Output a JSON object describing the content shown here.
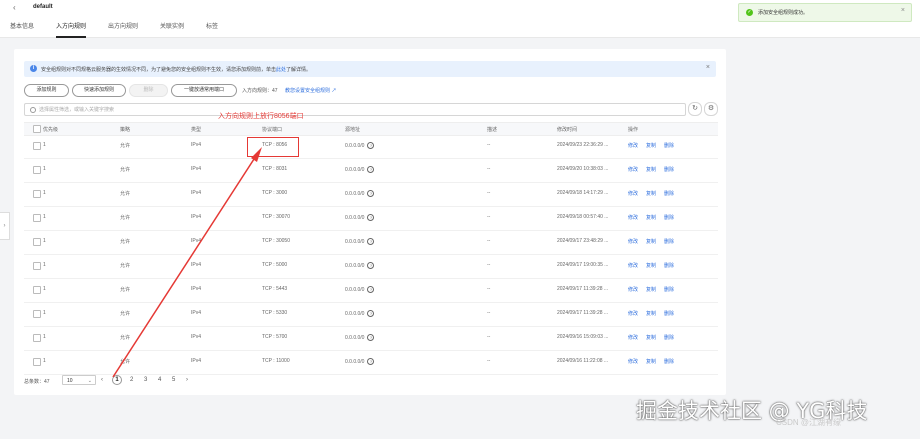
{
  "header": {
    "back_icon": "chevron-left-icon",
    "title": "default",
    "tabs": [
      {
        "label": "基本信息",
        "active": false
      },
      {
        "label": "入方向规则",
        "active": true
      },
      {
        "label": "出方向规则",
        "active": false
      },
      {
        "label": "关联实例",
        "active": false
      },
      {
        "label": "标签",
        "active": false
      }
    ]
  },
  "toast": {
    "icon": "check-circle-icon",
    "text": "添加安全组规则成功。",
    "close": "×"
  },
  "sidebar": {
    "toggle": "›"
  },
  "info_bar": {
    "icon": "info-icon",
    "text": "安全组规则对不同规格云服务器的生效情况不同，为了避免您的安全组规则不生效，请您添加规则前，单击",
    "link": "此处",
    "text_after": "了解详情。",
    "close": "×"
  },
  "toolbar": {
    "add_rule": "添加规则",
    "quick_add": "快速添加规则",
    "delete": "删除",
    "allow_common": "一键放通常用端口",
    "stat_label": "入方向规则：",
    "stat_count": "47",
    "teach_link": "教您设置安全组规则"
  },
  "search": {
    "placeholder": "选择属性筛选，或输入关键字搜索",
    "value": "",
    "refresh_icon": "↻",
    "settings_icon": "⚙"
  },
  "table": {
    "columns": [
      "优先级",
      "策略",
      "类型",
      "协议端口",
      "源地址",
      "描述",
      "修改时间",
      "操作"
    ],
    "rows": [
      {
        "priority": "1",
        "policy": "允许",
        "type": "IPv4",
        "port": "TCP : 8056",
        "source": "0.0.0.0/0",
        "desc": "--",
        "time": "2024/09/23 22:36:29 ..."
      },
      {
        "priority": "1",
        "policy": "允许",
        "type": "IPv4",
        "port": "TCP : 8031",
        "source": "0.0.0.0/0",
        "desc": "--",
        "time": "2024/09/20 10:38:03 ..."
      },
      {
        "priority": "1",
        "policy": "允许",
        "type": "IPv4",
        "port": "TCP : 3000",
        "source": "0.0.0.0/0",
        "desc": "--",
        "time": "2024/09/18 14:17:29 ..."
      },
      {
        "priority": "1",
        "policy": "允许",
        "type": "IPv4",
        "port": "TCP : 30070",
        "source": "0.0.0.0/0",
        "desc": "--",
        "time": "2024/09/18 00:57:40 ..."
      },
      {
        "priority": "1",
        "policy": "允许",
        "type": "IPv4",
        "port": "TCP : 30050",
        "source": "0.0.0.0/0",
        "desc": "--",
        "time": "2024/09/17 23:48:29 ..."
      },
      {
        "priority": "1",
        "policy": "允许",
        "type": "IPv4",
        "port": "TCP : 5000",
        "source": "0.0.0.0/0",
        "desc": "--",
        "time": "2024/09/17 19:00:35 ..."
      },
      {
        "priority": "1",
        "policy": "允许",
        "type": "IPv4",
        "port": "TCP : 5443",
        "source": "0.0.0.0/0",
        "desc": "--",
        "time": "2024/09/17 11:39:28 ..."
      },
      {
        "priority": "1",
        "policy": "允许",
        "type": "IPv4",
        "port": "TCP : 5330",
        "source": "0.0.0.0/0",
        "desc": "--",
        "time": "2024/09/17 11:39:28 ..."
      },
      {
        "priority": "1",
        "policy": "允许",
        "type": "IPv4",
        "port": "TCP : 5700",
        "source": "0.0.0.0/0",
        "desc": "--",
        "time": "2024/09/16 15:09:03 ..."
      },
      {
        "priority": "1",
        "policy": "允许",
        "type": "IPv4",
        "port": "TCP : 11000",
        "source": "0.0.0.0/0",
        "desc": "--",
        "time": "2024/09/16 11:22:08 ..."
      }
    ],
    "actions": [
      "修改",
      "复制",
      "删除"
    ],
    "source_icon": "?"
  },
  "annotation": {
    "text": "入方向规则上放行8056端口",
    "color": "#e53935"
  },
  "pagination": {
    "total_label": "总条数：47",
    "page_size": "10",
    "prev": "‹",
    "next": "›",
    "pages": [
      "1",
      "2",
      "3",
      "4",
      "5"
    ],
    "current": "1"
  },
  "watermark": {
    "text": "掘金技术社区 @ YG科技",
    "csdn": "CSDN @江湖有缘"
  }
}
